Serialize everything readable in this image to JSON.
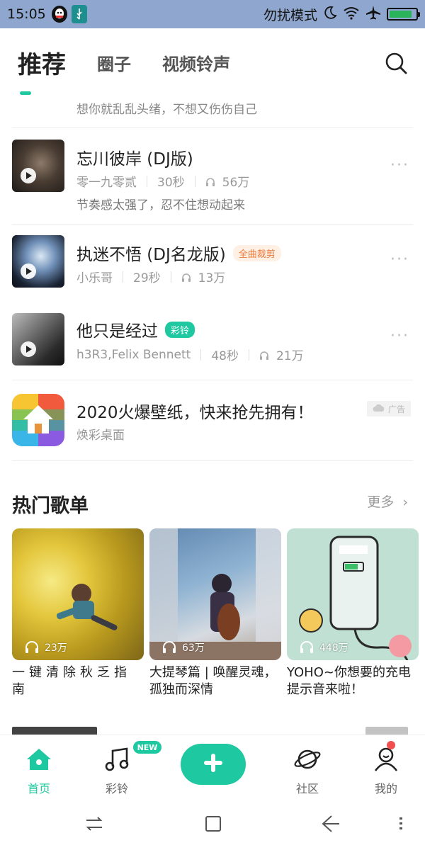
{
  "status_bar": {
    "time": "15:05",
    "dnd_text": "勿扰模式",
    "icons": [
      "qq-icon",
      "usb-icon",
      "moon-icon",
      "wifi-icon",
      "airplane-icon",
      "battery-icon"
    ],
    "battery_level": 0.85
  },
  "tabs": [
    {
      "label": "推荐",
      "active": true
    },
    {
      "label": "圈子",
      "active": false
    },
    {
      "label": "视频铃声",
      "active": false
    }
  ],
  "previous_snippet": "想你就乱乱头绪，不想又伤伤自己",
  "songs": [
    {
      "title": "忘川彼岸 (DJ版)",
      "artist": "零一九零贰",
      "duration": "30秒",
      "plays": "56万",
      "desc": "节奏感太强了，忍不住想动起来",
      "badge": ""
    },
    {
      "title": "执迷不悟 (DJ名龙版)",
      "artist": "小乐哥",
      "duration": "29秒",
      "plays": "13万",
      "desc": "",
      "badge": "全曲裁剪"
    },
    {
      "title": "他只是经过",
      "artist": "h3R3,Felix Bennett",
      "duration": "48秒",
      "plays": "21万",
      "desc": "",
      "badge": "彩铃"
    }
  ],
  "ad": {
    "title": "2020火爆壁纸，快来抢先拥有！",
    "subtitle": "焕彩桌面",
    "badge": "广告"
  },
  "hot_playlists": {
    "title": "热门歌单",
    "more": "更多",
    "items": [
      {
        "plays": "23万",
        "title": "一键清除秋乏指南"
      },
      {
        "plays": "63万",
        "title": "大提琴篇 | 唤醒灵魂，孤独而深情"
      },
      {
        "plays": "448万",
        "title": "YOHO~你想要的充电提示音来啦！"
      }
    ]
  },
  "bottom_nav": {
    "items": [
      {
        "label": "首页",
        "icon": "home-icon",
        "active": true
      },
      {
        "label": "彩铃",
        "icon": "music-note-icon",
        "active": false
      },
      {
        "label": "社区",
        "icon": "planet-icon",
        "active": false
      },
      {
        "label": "我的",
        "icon": "profile-icon",
        "active": false
      }
    ],
    "new_badge": "NEW",
    "center_icon": "plus-icon"
  },
  "colors": {
    "accent": "#1ec8a0",
    "status_bar": "#8fa7cf"
  }
}
